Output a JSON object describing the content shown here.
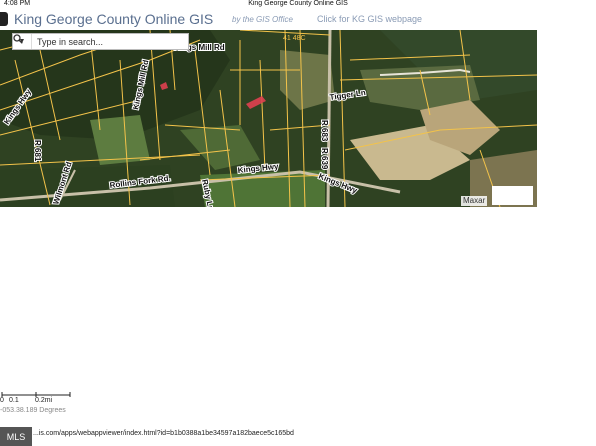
{
  "statusbar": {
    "time": "4:08 PM",
    "title": "King George County Online GIS"
  },
  "header": {
    "title": "King George County Online GIS",
    "byline": "by the GIS Office",
    "link": "Click for KG GIS webpage"
  },
  "search": {
    "placeholder": "Type in search..."
  },
  "map": {
    "labels": [
      "Kings Mill Rd",
      "Kings Mill Rd",
      "Kings Hwy",
      "Kings Hwy",
      "Kings Hwy",
      "Rollins Fork Rd.",
      "Ruby Ln",
      "Tigger Ln",
      "R 683",
      "R 639",
      "R 681",
      "Wilmont Rd",
      "41 48C"
    ],
    "attribution": "Maxar"
  },
  "scale": {
    "labels": [
      "0",
      "0.1",
      "0.2mi"
    ]
  },
  "coords": "-053.38.189 Degrees",
  "footer": {
    "badge": "MLS",
    "url": "...is.com/apps/webappviewer/index.html?id=b1b0388a1be34597a182baece5c165bd"
  },
  "colors": {
    "title": "#5a6f8f",
    "subtle": "#8a9bb5",
    "parcel": "#f3c34a",
    "highlight": "#e04050"
  }
}
